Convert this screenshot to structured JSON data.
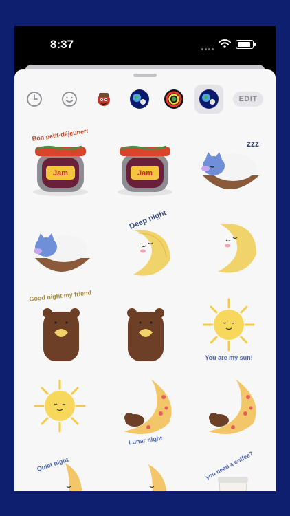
{
  "status_bar": {
    "time": "8:37"
  },
  "tabs": [
    {
      "icon": "clock-icon",
      "active": false
    },
    {
      "icon": "emoji-icon",
      "active": false
    },
    {
      "icon": "sticker-pack-character-icon",
      "active": false
    },
    {
      "icon": "sticker-pack-earth-moon-icon",
      "active": false
    },
    {
      "icon": "sticker-pack-rings-icon",
      "active": false
    },
    {
      "icon": "sticker-pack-earth-moon-icon",
      "active": true
    }
  ],
  "edit_label": "EDIT",
  "stickers": [
    {
      "kind": "jam-jar",
      "caption": "Bon petit-déjeuner!",
      "jar_label": "Jam"
    },
    {
      "kind": "jam-jar",
      "caption": "",
      "jar_label": "Jam"
    },
    {
      "kind": "sleeping-cat",
      "caption": "",
      "sleep_text": "zzz"
    },
    {
      "kind": "sleeping-cat",
      "caption": ""
    },
    {
      "kind": "moon",
      "caption": "Deep night"
    },
    {
      "kind": "moon",
      "caption": ""
    },
    {
      "kind": "bear",
      "caption": "Good night my friend"
    },
    {
      "kind": "bear",
      "caption": ""
    },
    {
      "kind": "sun",
      "caption": "You are my sun!"
    },
    {
      "kind": "sun",
      "caption": ""
    },
    {
      "kind": "moon-sleeper",
      "caption": "Lunar night"
    },
    {
      "kind": "moon-sleeper",
      "caption": ""
    },
    {
      "kind": "moon-small",
      "caption": "Quiet night"
    },
    {
      "kind": "moon-small",
      "caption": ""
    },
    {
      "kind": "coffee-cup",
      "caption": "you need a coffee?"
    }
  ]
}
